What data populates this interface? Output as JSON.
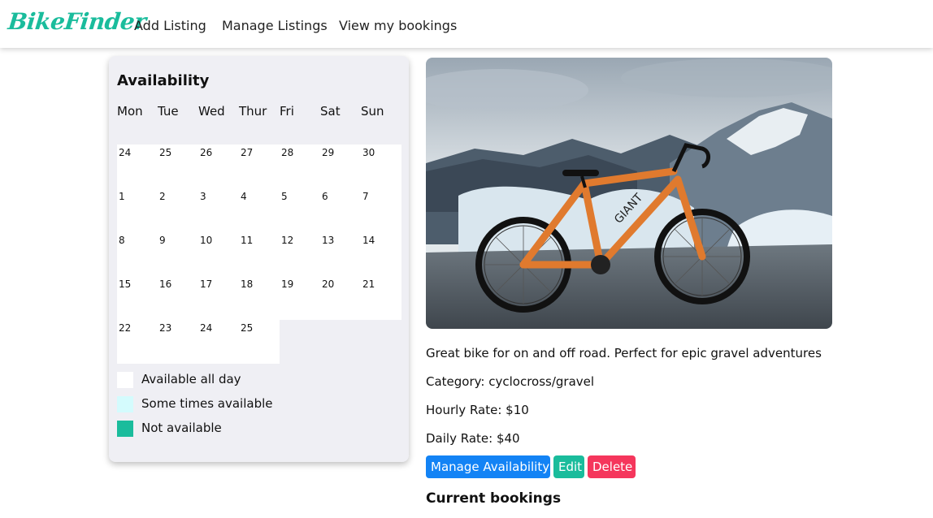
{
  "navbar": {
    "brand": "BikeFinder",
    "links": [
      "Add Listing",
      "Manage Listings",
      "View my bookings"
    ]
  },
  "calendar": {
    "title": "Availability",
    "days": [
      "Mon",
      "Tue",
      "Wed",
      "Thur",
      "Fri",
      "Sat",
      "Sun"
    ],
    "dates": [
      "24",
      "25",
      "26",
      "27",
      "28",
      "29",
      "30",
      "1",
      "2",
      "3",
      "4",
      "5",
      "6",
      "7",
      "8",
      "9",
      "10",
      "11",
      "12",
      "13",
      "14",
      "15",
      "16",
      "17",
      "18",
      "19",
      "20",
      "21",
      "22",
      "23",
      "24",
      "25"
    ],
    "legend": [
      {
        "label": "Available all day",
        "color": "#ffffff"
      },
      {
        "label": "Some times available",
        "color": "#d4fbfd"
      },
      {
        "label": "Not available",
        "color": "#1abc9c"
      }
    ]
  },
  "listing": {
    "description": "Great bike for on and off road. Perfect for epic gravel adventures",
    "category": "Category: cyclocross/gravel",
    "hourly_rate": "Hourly Rate: $10",
    "daily_rate": "Daily Rate: $40",
    "photo_icon": "bike-photo"
  },
  "actions": {
    "manage_availability": "Manage Availability",
    "edit": "Edit",
    "delete": "Delete",
    "colors": {
      "primary": "#1383f5",
      "edit": "#1abc9c",
      "delete": "#f5365c"
    }
  },
  "bookings": {
    "title": "Current bookings"
  }
}
